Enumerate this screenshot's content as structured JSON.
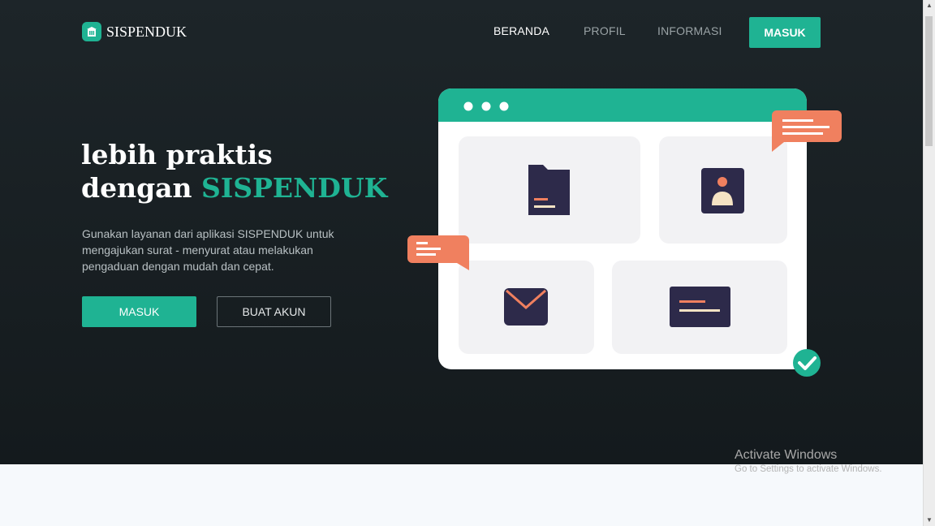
{
  "brand": {
    "name": "SISPENDUK",
    "icon": "building-icon"
  },
  "nav": {
    "links": [
      {
        "label": "BERANDA",
        "active": true
      },
      {
        "label": "PROFIL",
        "active": false
      },
      {
        "label": "INFORMASI",
        "active": false
      }
    ],
    "login_label": "MASUK"
  },
  "hero": {
    "title_line1": "lebih praktis",
    "title_line2_prefix": "dengan",
    "title_line2_accent": "SISPENDUK",
    "description": "Gunakan layanan dari aplikasi SISPENDUK untuk mengajukan surat - menyurat atau melakukan pengaduan dengan mudah dan cepat.",
    "primary_button": "MASUK",
    "secondary_button": "BUAT AKUN"
  },
  "illustration": {
    "icons": [
      "folder-icon",
      "id-card-icon",
      "envelope-icon",
      "card-icon",
      "chat-bubble-icon",
      "check-circle-icon"
    ]
  },
  "watermark": {
    "title": "Activate Windows",
    "subtitle": "Go to Settings to activate Windows."
  },
  "colors": {
    "accent": "#1fb393",
    "background": "#182024",
    "bubble": "#f0805f",
    "dark_icon": "#2d2a4a"
  }
}
